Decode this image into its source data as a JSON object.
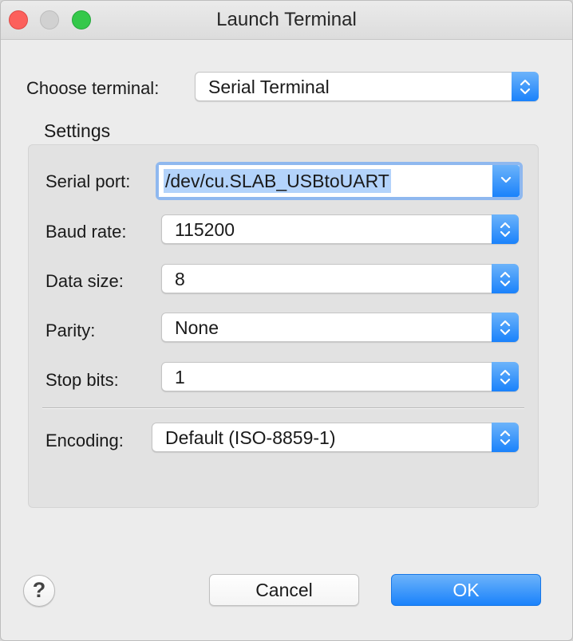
{
  "window": {
    "title": "Launch Terminal"
  },
  "terminal": {
    "label": "Choose terminal:",
    "value": "Serial Terminal"
  },
  "settings": {
    "heading": "Settings",
    "serial_port": {
      "label": "Serial port:",
      "value": "/dev/cu.SLAB_USBtoUART"
    },
    "baud_rate": {
      "label": "Baud rate:",
      "value": "115200"
    },
    "data_size": {
      "label": "Data size:",
      "value": "8"
    },
    "parity": {
      "label": "Parity:",
      "value": "None"
    },
    "stop_bits": {
      "label": "Stop bits:",
      "value": "1"
    },
    "encoding": {
      "label": "Encoding:",
      "value": "Default (ISO-8859-1)"
    }
  },
  "footer": {
    "help_glyph": "?",
    "cancel_label": "Cancel",
    "ok_label": "OK"
  },
  "icons": {
    "stepper": "up-down-chevron-icon",
    "dropdown": "chevron-down-icon",
    "help": "question-icon"
  },
  "colors": {
    "accent": "#1a82fb",
    "selection": "#b3d3fb",
    "focus_ring": "#8fb8ef"
  }
}
